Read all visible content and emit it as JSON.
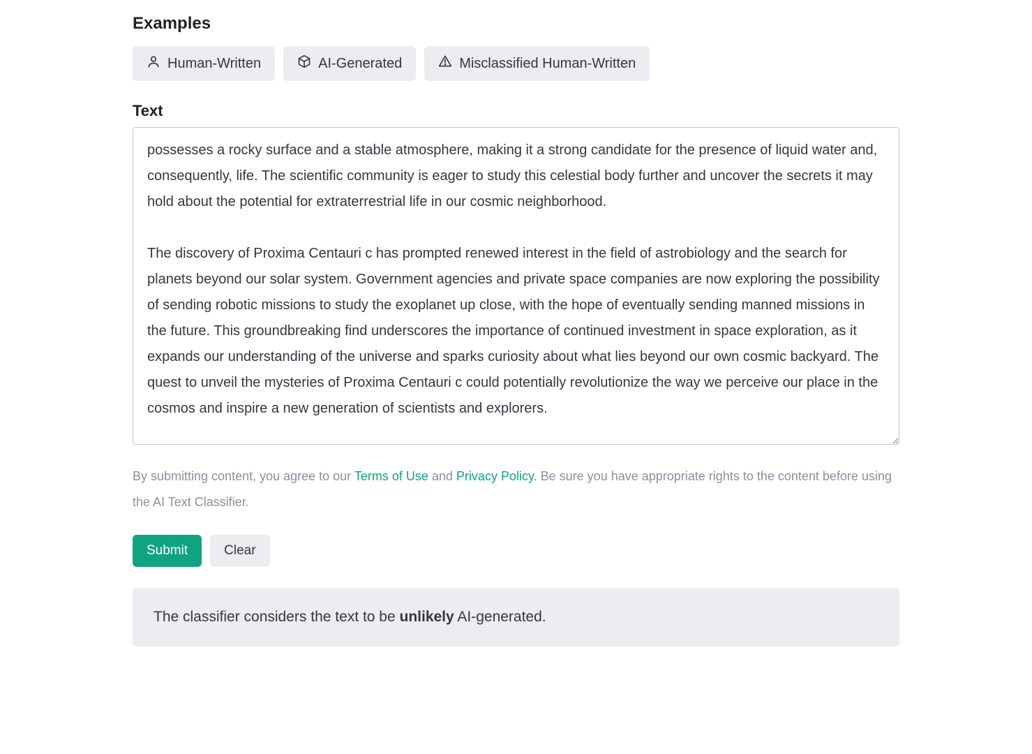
{
  "examples": {
    "heading": "Examples",
    "buttons": [
      {
        "label": "Human-Written"
      },
      {
        "label": "AI-Generated"
      },
      {
        "label": "Misclassified Human-Written"
      }
    ]
  },
  "text_section": {
    "label": "Text",
    "value": "possesses a rocky surface and a stable atmosphere, making it a strong candidate for the presence of liquid water and, consequently, life. The scientific community is eager to study this celestial body further and uncover the secrets it may hold about the potential for extraterrestrial life in our cosmic neighborhood.\n\nThe discovery of Proxima Centauri c has prompted renewed interest in the field of astrobiology and the search for planets beyond our solar system. Government agencies and private space companies are now exploring the possibility of sending robotic missions to study the exoplanet up close, with the hope of eventually sending manned missions in the future. This groundbreaking find underscores the importance of continued investment in space exploration, as it expands our understanding of the universe and sparks curiosity about what lies beyond our own cosmic backyard. The quest to unveil the mysteries of Proxima Centauri c could potentially revolutionize the way we perceive our place in the cosmos and inspire a new generation of scientists and explorers."
  },
  "disclaimer": {
    "prefix": "By submitting content, you agree to our ",
    "terms_label": "Terms of Use",
    "mid1": " and ",
    "privacy_label": "Privacy Policy",
    "suffix": ". Be sure you have appropriate rights to the content before using the AI Text Classifier."
  },
  "actions": {
    "submit": "Submit",
    "clear": "Clear"
  },
  "result": {
    "prefix": "The classifier considers the text to be ",
    "verdict": "unlikely",
    "suffix": " AI-generated."
  }
}
